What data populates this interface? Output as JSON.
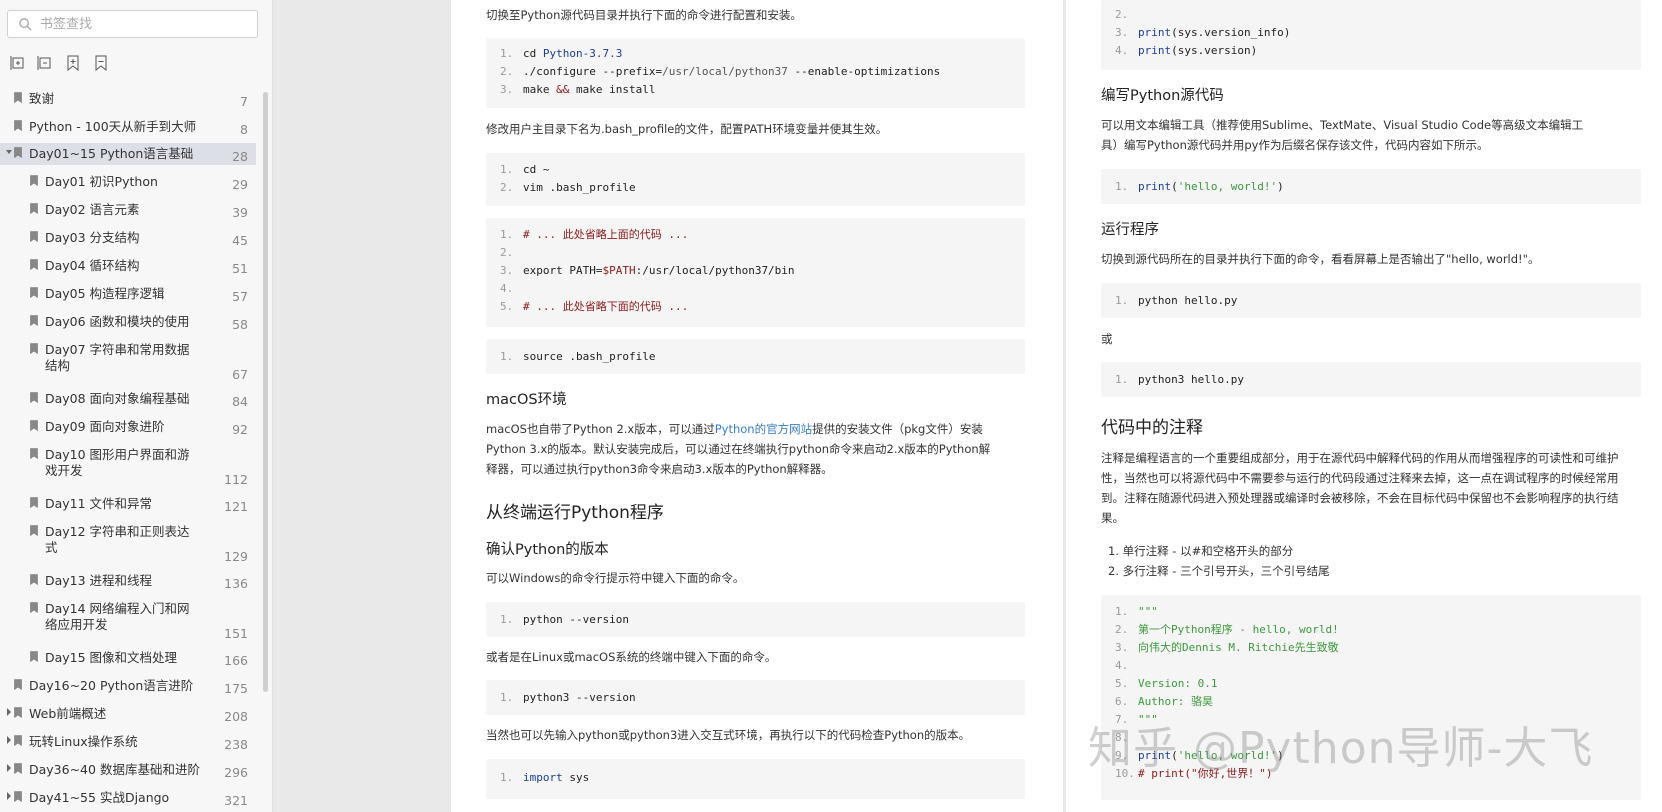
{
  "sidebar": {
    "search_placeholder": "书签查找",
    "tools": [
      "expand-all-icon",
      "collapse-all-icon",
      "add-bookmark-icon",
      "remove-bookmark-icon"
    ],
    "items": [
      {
        "label": "致谢",
        "page": "7",
        "level": 0,
        "caret": false
      },
      {
        "label": "Python - 100天从新手到大师",
        "page": "8",
        "level": 0,
        "caret": false
      },
      {
        "label": "Day01~15 Python语言基础",
        "page": "28",
        "level": 0,
        "caret": "open",
        "selected": true
      },
      {
        "label": "Day01 初识Python",
        "page": "29",
        "level": 1
      },
      {
        "label": "Day02 语言元素",
        "page": "39",
        "level": 1
      },
      {
        "label": "Day03 分支结构",
        "page": "45",
        "level": 1
      },
      {
        "label": "Day04 循环结构",
        "page": "51",
        "level": 1
      },
      {
        "label": "Day05 构造程序逻辑",
        "page": "57",
        "level": 1
      },
      {
        "label": "Day06 函数和模块的使用",
        "page": "58",
        "level": 1
      },
      {
        "label": "Day07 字符串和常用数据",
        "label2": "结构",
        "page": "67",
        "level": 1
      },
      {
        "label": "Day08 面向对象编程基础",
        "page": "84",
        "level": 1
      },
      {
        "label": "Day09 面向对象进阶",
        "page": "92",
        "level": 1
      },
      {
        "label": "Day10 图形用户界面和游",
        "label2": "戏开发",
        "page": "112",
        "level": 1
      },
      {
        "label": "Day11 文件和异常",
        "page": "121",
        "level": 1
      },
      {
        "label": "Day12 字符串和正则表达",
        "label2": "式",
        "page": "129",
        "level": 1
      },
      {
        "label": "Day13 进程和线程",
        "page": "136",
        "level": 1
      },
      {
        "label": "Day14 网络编程入门和网",
        "label2": "络应用开发",
        "page": "151",
        "level": 1
      },
      {
        "label": "Day15 图像和文档处理",
        "page": "166",
        "level": 1
      },
      {
        "label": "Day16~20 Python语言进阶",
        "page": "175",
        "level": 0,
        "caret": false
      },
      {
        "label": "Web前端概述",
        "page": "208",
        "level": 0,
        "caret": "closed"
      },
      {
        "label": "玩转Linux操作系统",
        "page": "238",
        "level": 0,
        "caret": "closed"
      },
      {
        "label": "Day36~40 数据库基础和进阶",
        "page": "296",
        "level": 0,
        "caret": "closed"
      },
      {
        "label": "Day41~55 实战Django",
        "page": "321",
        "level": 0,
        "caret": "closed"
      }
    ]
  },
  "page1": {
    "p_intro": "切换至Python源代码目录并执行下面的命令进行配置和安装。",
    "code1": [
      [
        {
          "t": "cd "
        },
        {
          "t": "Python-3.7.3",
          "c": "c-kw"
        }
      ],
      [
        {
          "t": "./configure --prefix="
        },
        {
          "t": "/usr/local/python37",
          "c": "c-gray"
        },
        {
          "t": " --enable-optimizations"
        }
      ],
      [
        {
          "t": "make "
        },
        {
          "t": "&&",
          "c": "c-cmt"
        },
        {
          "t": " make install"
        }
      ]
    ],
    "p_bash": "修改用户主目录下名为.bash_profile的文件，配置PATH环境变量并使其生效。",
    "code2": [
      [
        {
          "t": "cd ~"
        }
      ],
      [
        {
          "t": "vim .bash_profile"
        }
      ]
    ],
    "code3": [
      [
        {
          "t": "# ... 此处省略上面的代码 ...",
          "c": "c-cmt"
        }
      ],
      [
        {
          "t": ""
        }
      ],
      [
        {
          "t": "export PATH="
        },
        {
          "t": "$PATH",
          "c": "c-cmt"
        },
        {
          "t": ":/usr/local/python37/bin"
        }
      ],
      [
        {
          "t": ""
        }
      ],
      [
        {
          "t": "# ... 此处省略下面的代码 ...",
          "c": "c-cmt"
        }
      ]
    ],
    "code4": [
      [
        {
          "t": "source .bash_profile"
        }
      ]
    ],
    "h_macos": "macOS环境",
    "p_macos_1a": "macOS也自带了Python 2.x版本，可以通过",
    "p_macos_link": "Python的官方网站",
    "p_macos_1b": "提供的安装文件（pkg文件）安装",
    "p_macos_2": "Python 3.x的版本。默认安装完成后，可以通过在终端执行python命令来启动2.x版本的Python解",
    "p_macos_3": "释器，可以通过执行python3命令来启动3.x版本的Python解释器。",
    "h_run": "从终端运行Python程序",
    "h_confirm": "确认Python的版本",
    "p_windows": "可以Windows的命令行提示符中键入下面的命令。",
    "code5": [
      [
        {
          "t": "python --version"
        }
      ]
    ],
    "p_linux": "或者是在Linux或macOS系统的终端中键入下面的命令。",
    "code6": [
      [
        {
          "t": "python3 --version"
        }
      ]
    ],
    "p_interactive": "当然也可以先输入python或python3进入交互式环境，再执行以下的代码检查Python的版本。",
    "code7": [
      [
        {
          "t": "import",
          "c": "c-kw"
        },
        {
          "t": " sys"
        }
      ]
    ]
  },
  "page2": {
    "code_top": [
      {
        "n": "2.",
        "line": [
          {
            "t": ""
          }
        ]
      },
      {
        "n": "3.",
        "line": [
          {
            "t": "print",
            "c": "c-kw"
          },
          {
            "t": "(sys.version_info)"
          }
        ]
      },
      {
        "n": "4.",
        "line": [
          {
            "t": "print",
            "c": "c-kw"
          },
          {
            "t": "(sys.version)"
          }
        ]
      }
    ],
    "h_write": "编写Python源代码",
    "p_write_1": "可以用文本编辑工具（推荐使用Sublime、TextMate、Visual Studio Code等高级文本编辑工",
    "p_write_2": "具）编写Python源代码并用py作为后缀名保存该文件，代码内容如下所示。",
    "code_hello": [
      [
        {
          "t": "print",
          "c": "c-kw"
        },
        {
          "t": "("
        },
        {
          "t": "'hello, world!'",
          "c": "c-str"
        },
        {
          "t": ")"
        }
      ]
    ],
    "h_run": "运行程序",
    "p_run": "切换到源代码所在的目录并执行下面的命令，看看屏幕上是否输出了\"hello, world!\"。",
    "code_run1": [
      [
        {
          "t": "python hello.py"
        }
      ]
    ],
    "p_or": "或",
    "code_run2": [
      [
        {
          "t": "python3 hello.py"
        }
      ]
    ],
    "h_comments": "代码中的注释",
    "p_c1": "注释是编程语言的一个重要组成部分，用于在源代码中解释代码的作用从而增强程序的可读性和可维护",
    "p_c2": "性，当然也可以将源代码中不需要参与运行的代码段通过注释来去掉，这一点在调试程序的时候经常用",
    "p_c3": "到。注释在随源代码进入预处理器或编译时会被移除，不会在目标代码中保留也不会影响程序的执行结",
    "p_c4": "果。",
    "list": [
      "1.  单行注释 - 以#和空格开头的部分",
      "2.  多行注释 - 三个引号开头，三个引号结尾"
    ],
    "code_doc": [
      {
        "n": "1.",
        "line": [
          {
            "t": "\"\"\"",
            "c": "c-str"
          }
        ]
      },
      {
        "n": "2.",
        "line": [
          {
            "t": "第一个Python程序 - hello, world!",
            "c": "c-str"
          }
        ]
      },
      {
        "n": "3.",
        "line": [
          {
            "t": "向伟大的Dennis M. Ritchie先生致敬",
            "c": "c-str"
          }
        ]
      },
      {
        "n": "4.",
        "line": [
          {
            "t": ""
          }
        ]
      },
      {
        "n": "5.",
        "line": [
          {
            "t": "Version: 0.1",
            "c": "c-str"
          }
        ]
      },
      {
        "n": "6.",
        "line": [
          {
            "t": "Author: 骆昊",
            "c": "c-str"
          }
        ]
      },
      {
        "n": "7.",
        "line": [
          {
            "t": "\"\"\"",
            "c": "c-str"
          }
        ]
      },
      {
        "n": "8.",
        "line": [
          {
            "t": ""
          }
        ]
      },
      {
        "n": "9.",
        "line": [
          {
            "t": "print",
            "c": "c-kw"
          },
          {
            "t": "("
          },
          {
            "t": "'hello, world!'",
            "c": "c-str"
          },
          {
            "t": ")"
          }
        ]
      },
      {
        "n": "10.",
        "line": [
          {
            "t": "# print(\"你好,世界！\")",
            "c": "c-cmt"
          }
        ]
      }
    ]
  },
  "watermark": "知乎 @Python导师-大飞"
}
